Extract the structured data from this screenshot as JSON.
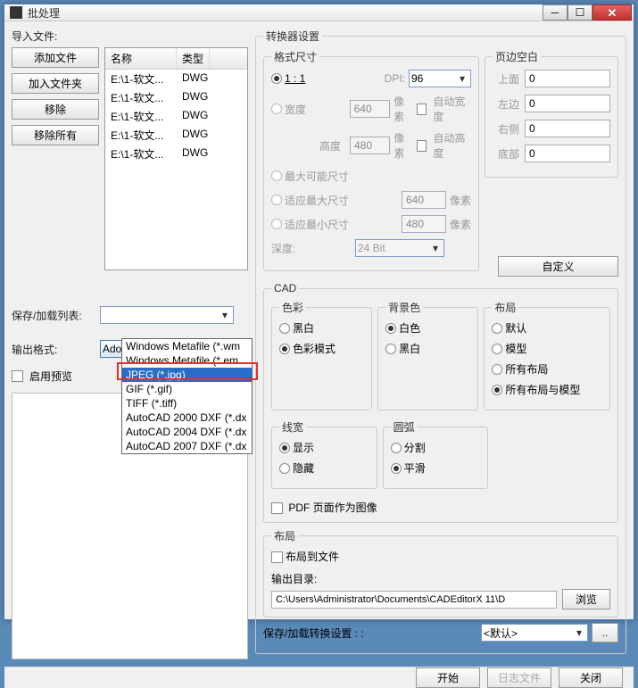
{
  "window": {
    "title": "批处理"
  },
  "left": {
    "import_label": "导入文件:",
    "btn_add_file": "添加文件",
    "btn_add_folder": "加入文件夹",
    "btn_remove": "移除",
    "btn_remove_all": "移除所有",
    "col_name": "名称",
    "col_type": "类型",
    "files": [
      {
        "name": "E:\\1-软文...",
        "type": "DWG"
      },
      {
        "name": "E:\\1-软文...",
        "type": "DWG"
      },
      {
        "name": "E:\\1-软文...",
        "type": "DWG"
      },
      {
        "name": "E:\\1-软文...",
        "type": "DWG"
      },
      {
        "name": "E:\\1-软文...",
        "type": "DWG"
      }
    ],
    "save_list_label": "保存/加载列表:",
    "output_format_label": "输出格式:",
    "output_format_value": "Adobe Acrobat Docume",
    "dropdown_options": [
      "Windows Metafile (*.wm",
      "Windows Metafile (*.em",
      "JPEG (*.jpg)",
      "GIF (*.gif)",
      "TIFF (*.tiff)",
      "AutoCAD 2000 DXF (*.dx",
      "AutoCAD 2004 DXF (*.dx",
      "AutoCAD 2007 DXF (*.dx"
    ],
    "dropdown_selected_index": 2,
    "enable_preview": "启用预览"
  },
  "right": {
    "converter_settings": "转换器设置",
    "format_size": "格式尺寸",
    "ratio_11": "1 : 1",
    "dpi_label": "DPI:",
    "dpi_value": "96",
    "width_label": "宽度",
    "width_value": "640",
    "px": "像素",
    "auto_width": "自动宽度",
    "height_label": "高度",
    "height_value": "480",
    "auto_height": "自动高度",
    "max_size": "最大可能尺寸",
    "fit_max": "适应最大尺寸",
    "fit_max_value": "640",
    "fit_min": "适应最小尺寸",
    "fit_min_value": "480",
    "depth_label": "深度:",
    "depth_value": "24 Bit",
    "margin": {
      "legend": "页边空白",
      "top": "上面",
      "left": "左边",
      "right": "右侧",
      "bottom": "底部",
      "val": "0"
    },
    "custom_btn": "自定义",
    "cad": {
      "legend": "CAD",
      "color": {
        "legend": "色彩",
        "bw": "黑白",
        "color_mode": "色彩模式"
      },
      "bg": {
        "legend": "背景色",
        "white": "白色",
        "black": "黑白"
      },
      "layout": {
        "legend": "布局",
        "default": "默认",
        "model": "模型",
        "all": "所有布局",
        "all_model": "所有布局与模型"
      },
      "linewidth": {
        "legend": "线宽",
        "show": "显示",
        "hide": "隐藏"
      },
      "arc": {
        "legend": "圆弧",
        "split": "分割",
        "smooth": "平滑"
      },
      "pdf_as_image": "PDF 页面作为图像"
    },
    "layout_box": {
      "legend": "布局",
      "layout_to_file": "布局到文件",
      "outdir_label": "输出目录:",
      "outdir_value": "C:\\Users\\Administrator\\Documents\\CADEditorX 11\\D",
      "browse": "浏览"
    },
    "save_convert_label": "保存/加载转换设置 : :",
    "save_convert_value": "<默认>"
  },
  "footer": {
    "start": "开始",
    "log": "日志文件",
    "close": "关闭"
  }
}
